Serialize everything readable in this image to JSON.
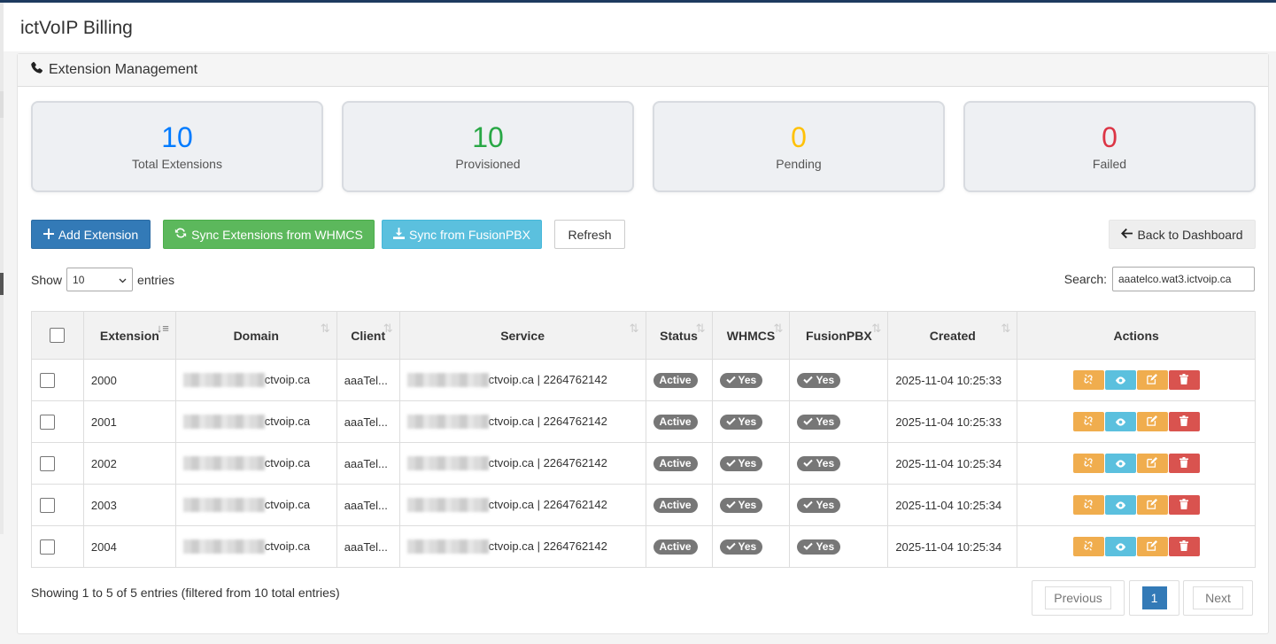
{
  "app": {
    "title": "ictVoIP Billing"
  },
  "panel": {
    "heading": "Extension Management"
  },
  "stats": [
    {
      "value": "10",
      "label": "Total Extensions",
      "color": "#007bff"
    },
    {
      "value": "10",
      "label": "Provisioned",
      "color": "#28a745"
    },
    {
      "value": "0",
      "label": "Pending",
      "color": "#ffc107"
    },
    {
      "value": "0",
      "label": "Failed",
      "color": "#dc3545"
    }
  ],
  "toolbar": {
    "add_label": "Add Extension",
    "sync_whmcs_label": "Sync Extensions from WHMCS",
    "sync_fusion_label": "Sync from FusionPBX",
    "refresh_label": "Refresh",
    "back_label": "Back to Dashboard"
  },
  "length": {
    "show_label": "Show",
    "value": "10",
    "entries_label": "entries"
  },
  "search": {
    "label": "Search:",
    "value": "aaatelco.wat3.ictvoip.ca"
  },
  "table": {
    "columns": [
      "Extension",
      "Domain",
      "Client",
      "Service",
      "Status",
      "WHMCS",
      "FusionPBX",
      "Created",
      "Actions"
    ],
    "rows": [
      {
        "extension": "2000",
        "domain": "ctvoip.ca",
        "client": "aaaTel...",
        "service": "ctvoip.ca | 2264762142",
        "status": "Active",
        "whmcs": "Yes",
        "fusionpbx": "Yes",
        "created": "2025-11-04 10:25:33"
      },
      {
        "extension": "2001",
        "domain": "ctvoip.ca",
        "client": "aaaTel...",
        "service": "ctvoip.ca | 2264762142",
        "status": "Active",
        "whmcs": "Yes",
        "fusionpbx": "Yes",
        "created": "2025-11-04 10:25:33"
      },
      {
        "extension": "2002",
        "domain": "ctvoip.ca",
        "client": "aaaTel...",
        "service": "ctvoip.ca | 2264762142",
        "status": "Active",
        "whmcs": "Yes",
        "fusionpbx": "Yes",
        "created": "2025-11-04 10:25:34"
      },
      {
        "extension": "2003",
        "domain": "ctvoip.ca",
        "client": "aaaTel...",
        "service": "ctvoip.ca | 2264762142",
        "status": "Active",
        "whmcs": "Yes",
        "fusionpbx": "Yes",
        "created": "2025-11-04 10:25:34"
      },
      {
        "extension": "2004",
        "domain": "ctvoip.ca",
        "client": "aaaTel...",
        "service": "ctvoip.ca | 2264762142",
        "status": "Active",
        "whmcs": "Yes",
        "fusionpbx": "Yes",
        "created": "2025-11-04 10:25:34"
      }
    ]
  },
  "footer": {
    "info": "Showing 1 to 5 of 5 entries (filtered from 10 total entries)",
    "previous": "Previous",
    "page": "1",
    "next": "Next"
  }
}
